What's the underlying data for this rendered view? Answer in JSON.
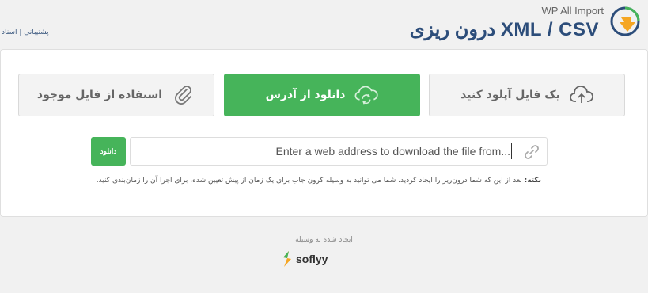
{
  "header": {
    "support_links": "پشتیبانی | اسناد",
    "product_name": "WP All Import",
    "page_title": "درون ریزی XML / CSV"
  },
  "import_options": [
    {
      "label": "یک فایل آپلود کنید",
      "icon": "cloud-upload-icon",
      "active": false
    },
    {
      "label": "دانلود از آدرس",
      "icon": "cloud-sync-icon",
      "active": true
    },
    {
      "label": "استفاده از فایل موجود",
      "icon": "paperclip-icon",
      "active": false
    }
  ],
  "url_form": {
    "download_button": "دانلود",
    "placeholder": "Enter a web address to download the file from..."
  },
  "note": {
    "label": "نکته:",
    "text": " بعد از این که شما درون‌ریز را ایجاد کردید، شما می توانید به وسیله کرون جاب برای یک زمان از پیش تعیین شده، برای اجرا آن را زمان‌بندی کنید."
  },
  "footer": {
    "created_by": "ایجاد شده به وسیله",
    "brand": "soflyy"
  },
  "colors": {
    "accent_green": "#46b45a",
    "title_blue": "#2c4d7a",
    "background": "#f1f1f1"
  }
}
